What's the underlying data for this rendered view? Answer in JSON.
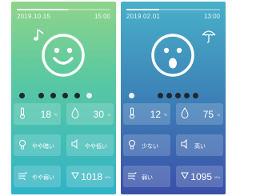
{
  "left": {
    "progress_fraction": 0.55,
    "date": "2019.10.15",
    "time": "15:00",
    "face_icon": "smiling-face-icon",
    "weather_icon": "music-note-icon",
    "dot_labels": [
      "",
      "",
      "",
      "",
      "",
      ""
    ],
    "cards": {
      "temperature": {
        "icon": "thermometer-icon",
        "value": "18",
        "unit": "℃"
      },
      "humidity": {
        "icon": "humidity-icon",
        "value": "30",
        "unit": "%"
      },
      "light": {
        "icon": "light-icon",
        "text": "やや暗い"
      },
      "noise": {
        "icon": "noise-icon",
        "text": "やや低い"
      },
      "wind": {
        "icon": "wind-icon",
        "text": "やや弱い"
      },
      "pressure": {
        "icon": "pressure-icon",
        "value": "1018",
        "unit": "hPa"
      }
    }
  },
  "right": {
    "progress_fraction": 0.35,
    "date": "2019.02.01",
    "time": "13:00",
    "face_icon": "surprised-face-icon",
    "weather_icon": "umbrella-icon",
    "dot_labels": [
      "",
      "",
      "",
      "",
      "",
      ""
    ],
    "cards": {
      "temperature": {
        "icon": "thermometer-icon",
        "value": "12",
        "unit": "℃"
      },
      "humidity": {
        "icon": "humidity-icon",
        "value": "75",
        "unit": "%"
      },
      "light": {
        "icon": "light-icon",
        "text": "少ない"
      },
      "noise": {
        "icon": "noise-icon",
        "text": "高い"
      },
      "wind": {
        "icon": "wind-icon",
        "text": "弱い"
      },
      "pressure": {
        "icon": "pressure-icon",
        "value": "1095",
        "unit": "hPa"
      }
    }
  }
}
